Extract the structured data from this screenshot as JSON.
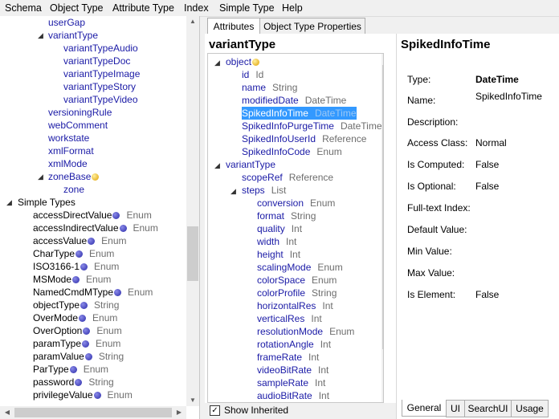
{
  "menu": [
    "Schema",
    "Object Type",
    "Attribute Type",
    "Index",
    "Simple Type",
    "Help"
  ],
  "left_tree": {
    "nodes_a": [
      {
        "label": "userGap"
      },
      {
        "label": "variantType"
      },
      {
        "label": "variantTypeAudio"
      },
      {
        "label": "variantTypeDoc"
      },
      {
        "label": "variantTypeImage"
      },
      {
        "label": "variantTypeStory"
      },
      {
        "label": "variantTypeVideo"
      },
      {
        "label": "versioningRule"
      },
      {
        "label": "webComment"
      },
      {
        "label": "workstate"
      },
      {
        "label": "xmlFormat"
      },
      {
        "label": "xmlMode"
      },
      {
        "label": "zoneBase"
      },
      {
        "label": "zone"
      }
    ],
    "simple_types_label": "Simple Types",
    "simple_types": [
      {
        "label": "accessDirectValue",
        "type": "Enum"
      },
      {
        "label": "accessIndirectValue",
        "type": "Enum"
      },
      {
        "label": "accessValue",
        "type": "Enum"
      },
      {
        "label": "CharType",
        "type": "Enum"
      },
      {
        "label": "ISO3166-1",
        "type": "Enum"
      },
      {
        "label": "MSMode",
        "type": "Enum"
      },
      {
        "label": "NamedCmdMType",
        "type": "Enum"
      },
      {
        "label": "objectType",
        "type": "String"
      },
      {
        "label": "OverMode",
        "type": "Enum"
      },
      {
        "label": "OverOption",
        "type": "Enum"
      },
      {
        "label": "paramType",
        "type": "Enum"
      },
      {
        "label": "paramValue",
        "type": "String"
      },
      {
        "label": "ParType",
        "type": "Enum"
      },
      {
        "label": "password",
        "type": "String"
      },
      {
        "label": "privilegeValue",
        "type": "Enum"
      }
    ]
  },
  "tabs": {
    "attributes": "Attributes",
    "object_type_properties": "Object Type Properties"
  },
  "middle": {
    "title": "variantType",
    "object_node": "object",
    "object_attrs": [
      {
        "name": "id",
        "type": "Id"
      },
      {
        "name": "name",
        "type": "String"
      },
      {
        "name": "modifiedDate",
        "type": "DateTime"
      },
      {
        "name": "SpikedInfoTime",
        "type": "DateTime"
      },
      {
        "name": "SpikedInfoPurgeTime",
        "type": "DateTime"
      },
      {
        "name": "SpikedInfoUserId",
        "type": "Reference"
      },
      {
        "name": "SpikedInfoCode",
        "type": "Enum"
      }
    ],
    "variant_node": "variantType",
    "scope": {
      "name": "scopeRef",
      "type": "Reference"
    },
    "steps": {
      "name": "steps",
      "type": "List"
    },
    "step_attrs": [
      {
        "name": "conversion",
        "type": "Enum"
      },
      {
        "name": "format",
        "type": "String"
      },
      {
        "name": "quality",
        "type": "Int"
      },
      {
        "name": "width",
        "type": "Int"
      },
      {
        "name": "height",
        "type": "Int"
      },
      {
        "name": "scalingMode",
        "type": "Enum"
      },
      {
        "name": "colorSpace",
        "type": "Enum"
      },
      {
        "name": "colorProfile",
        "type": "String"
      },
      {
        "name": "horizontalRes",
        "type": "Int"
      },
      {
        "name": "verticalRes",
        "type": "Int"
      },
      {
        "name": "resolutionMode",
        "type": "Enum"
      },
      {
        "name": "rotationAngle",
        "type": "Int"
      },
      {
        "name": "frameRate",
        "type": "Int"
      },
      {
        "name": "videoBitRate",
        "type": "Int"
      },
      {
        "name": "sampleRate",
        "type": "Int"
      },
      {
        "name": "audioBitRate",
        "type": "Int"
      }
    ],
    "show_inherited": "Show Inherited"
  },
  "right": {
    "title": "SpikedInfoTime",
    "props": [
      {
        "label": "Type:",
        "value": "DateTime"
      },
      {
        "label": "Name:",
        "value": "SpikedInfoTime"
      },
      {
        "label": "Description:",
        "value": ""
      },
      {
        "label": "Access Class:",
        "value": "Normal"
      },
      {
        "label": "Is Computed:",
        "value": "False"
      },
      {
        "label": "Is Optional:",
        "value": "False"
      },
      {
        "label": "Full-text Index:",
        "value": ""
      },
      {
        "label": "Default Value:",
        "value": ""
      },
      {
        "label": "Min Value:",
        "value": ""
      },
      {
        "label": "Max Value:",
        "value": ""
      },
      {
        "label": "Is Element:",
        "value": "False"
      }
    ],
    "bottom_tabs": [
      "General",
      "UI",
      "SearchUI",
      "Usage"
    ]
  }
}
